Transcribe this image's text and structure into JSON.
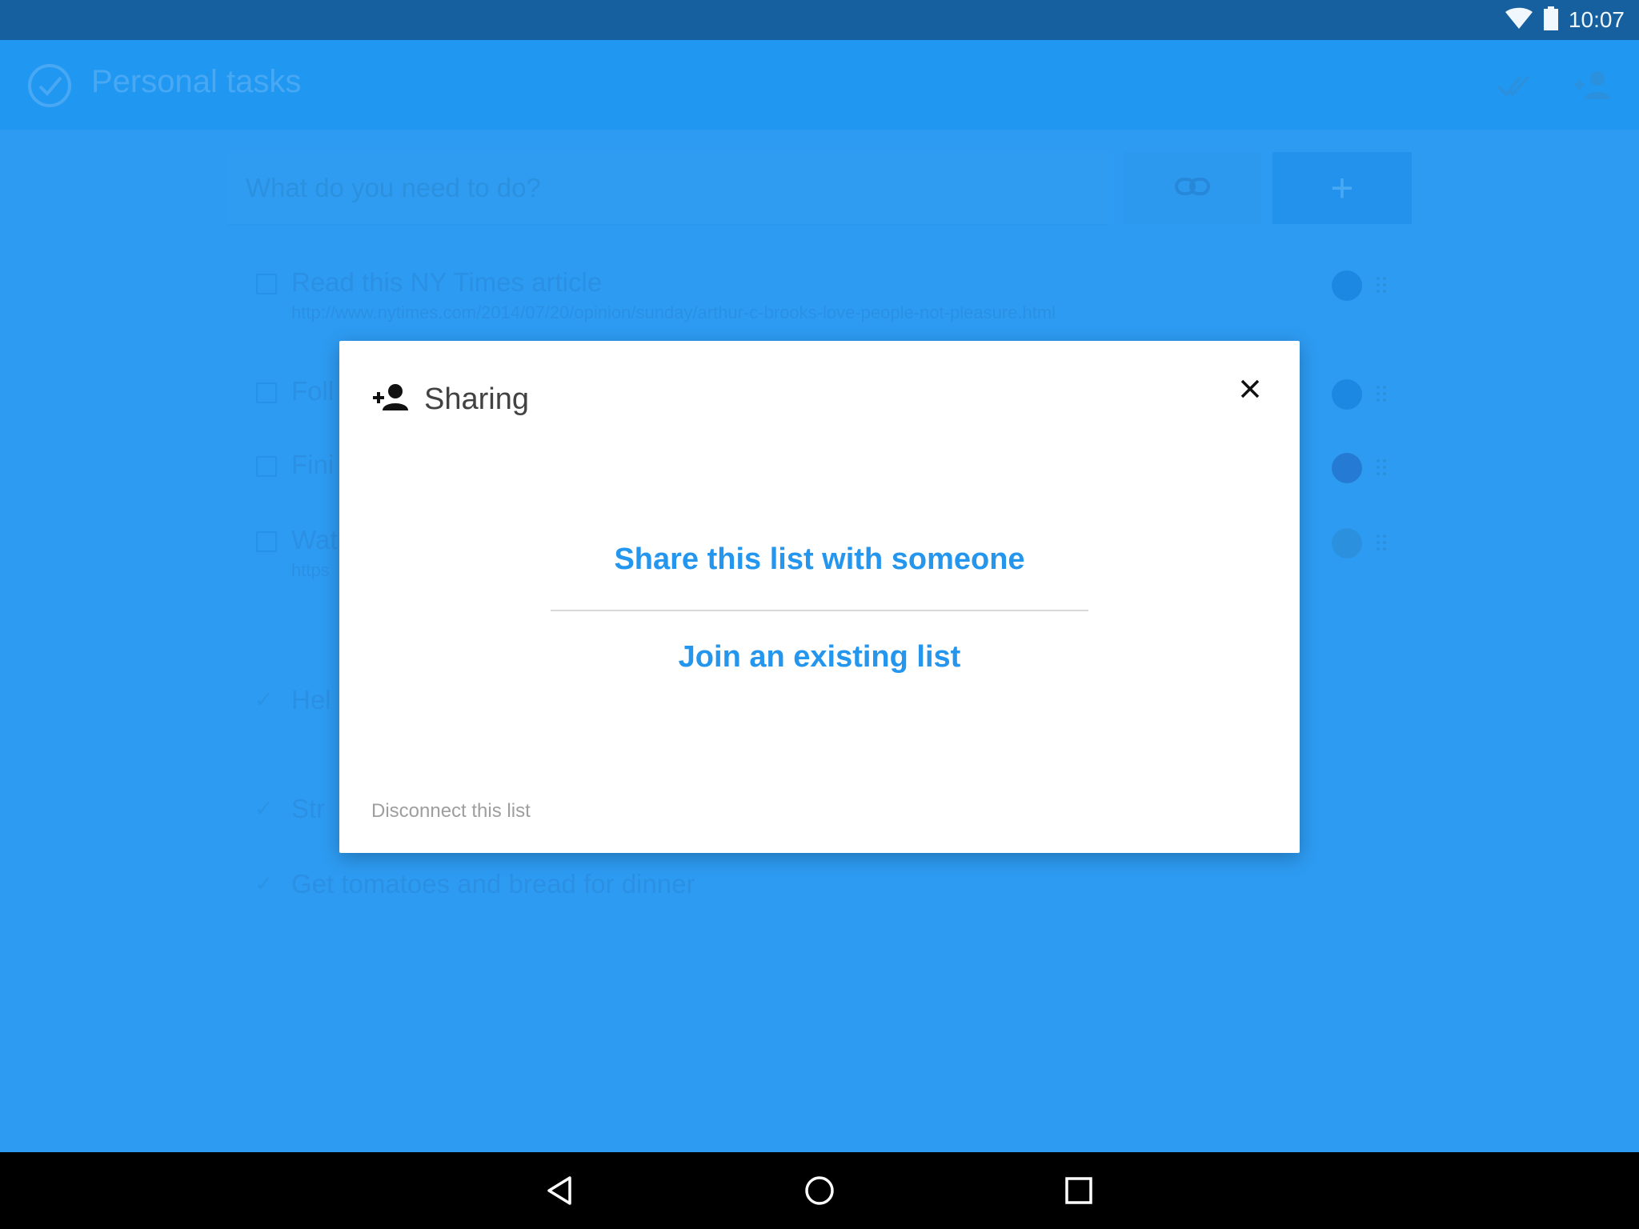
{
  "status_bar": {
    "time": "10:07",
    "icons": [
      "wifi-icon",
      "battery-icon"
    ]
  },
  "app_bar": {
    "title": "Personal tasks",
    "icons": [
      "logo-check-icon",
      "done-all-icon",
      "person-add-icon"
    ]
  },
  "task_input": {
    "placeholder": "What do you need to do?",
    "link_icon": "link-icon",
    "add_label": "+"
  },
  "tasks": [
    {
      "title": "Read this NY Times article",
      "url": "http://www.nytimes.com/2014/07/20/opinion/sunday/arthur-c-brooks-love-people-not-pleasure.html",
      "done": false,
      "color": "#1a86e0"
    },
    {
      "title": "Foll",
      "done": false,
      "color": "#1a86e0"
    },
    {
      "title": "Fini",
      "done": false,
      "color": "#2378d2"
    },
    {
      "title": "Wat",
      "url": "https",
      "done": false,
      "color": "#2a90de"
    },
    {
      "title": "Hel",
      "done": true
    },
    {
      "title": "Str",
      "done": true
    },
    {
      "title": "Get tomatoes and bread for dinner",
      "done": true
    }
  ],
  "dialog": {
    "title": "Sharing",
    "share_label": "Share this list with someone",
    "join_label": "Join an existing list",
    "disconnect_label": "Disconnect this list"
  },
  "nav_bar": {
    "buttons": [
      "back-icon",
      "home-icon",
      "recents-icon"
    ]
  },
  "colors": {
    "background": "#2c9bf2",
    "status_bar": "#135b98",
    "accent": "#2496ee"
  }
}
